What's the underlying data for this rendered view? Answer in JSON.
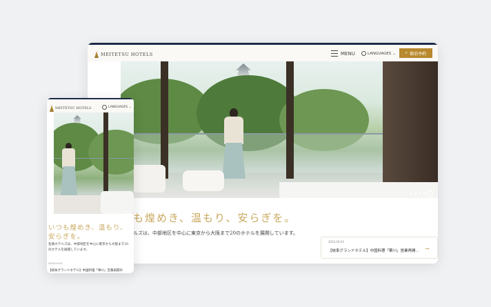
{
  "desktop": {
    "logo_text": "MEITETSU HOTELS",
    "menu_label": "MENU",
    "language_label": "LANGUAGES",
    "booking_label": "宿泊予約",
    "tagline": "も煌めき、温もり、安らぎを。",
    "subtext": "ルズは、中部地区を中心に東京から大阪まで20のホテルを展開しています。",
    "news": {
      "date": "2024.04.03",
      "title": "【岐阜グランドホテル】中国料理「華川」営業再開…"
    }
  },
  "mobile": {
    "logo_text": "MEITETSU HOTELS",
    "language_label": "LANGUAGES",
    "tagline": "いつも煌めき、温もり、安らぎを。",
    "subtext": "名鉄ホテルズは、中部地区を中心に東京から大阪まで20のホテルを展開しています。",
    "news": {
      "date": "2024.04.03",
      "title": "【岐阜グランドホテル】中国料理「華川」営業再開の"
    }
  },
  "colors": {
    "accent": "#b8892e",
    "navy": "#1d2a4a",
    "gold_text": "#c9a85e"
  },
  "icons": [
    "hamburger-icon",
    "globe-icon",
    "chevron-down-icon",
    "search-icon",
    "arrow-right-icon",
    "pause-icon"
  ]
}
